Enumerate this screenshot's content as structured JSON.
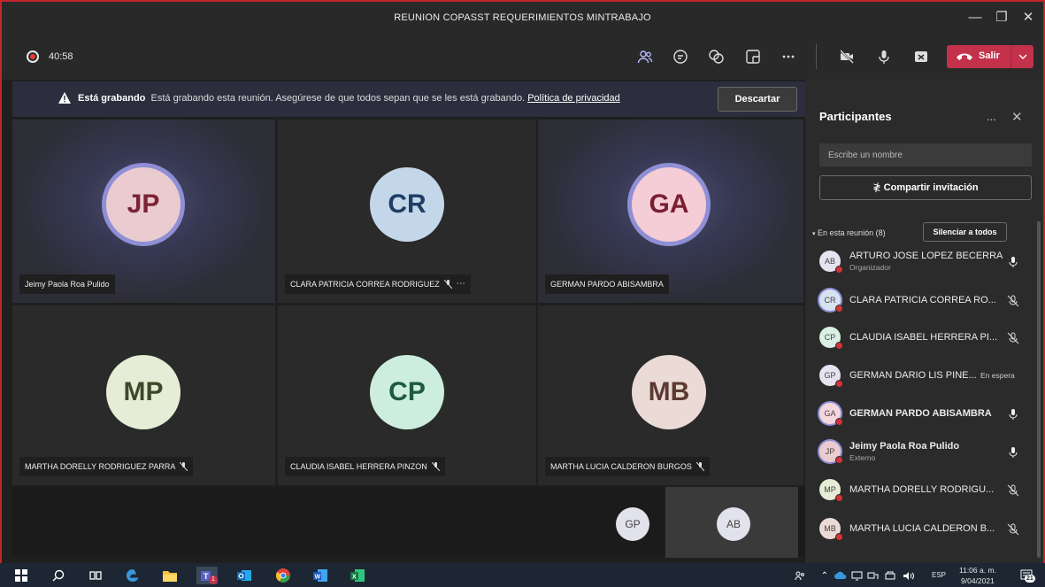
{
  "window": {
    "title": "REUNION COPASST REQUERIMIENTOS MINTRABAJO"
  },
  "toolbar": {
    "timer": "40:58",
    "leave_label": "Salir"
  },
  "banner": {
    "bold": "Está grabando",
    "text": "Está grabando esta reunión. Asegúrese de que todos sepan que se les está grabando.",
    "link": "Política de privacidad",
    "dismiss": "Descartar"
  },
  "tiles": [
    {
      "initials": "JP",
      "name": "Jeimy Paola Roa Pulido",
      "bg": "#eacbcf",
      "fg": "#7a2335"
    },
    {
      "initials": "CR",
      "name": "CLARA PATRICIA CORREA RODRIGUEZ",
      "bg": "#c4d7ea",
      "fg": "#1f3e64"
    },
    {
      "initials": "GA",
      "name": "GERMAN PARDO ABISAMBRA",
      "bg": "#f5cdd6",
      "fg": "#7a1f32"
    },
    {
      "initials": "MP",
      "name": "MARTHA DORELLY RODRIGUEZ PARRA",
      "bg": "#e6edd6",
      "fg": "#3c4a2a"
    },
    {
      "initials": "CP",
      "name": "CLAUDIA ISABEL HERRERA PINZON",
      "bg": "#cdeedf",
      "fg": "#1e5a3e"
    },
    {
      "initials": "MB",
      "name": "MARTHA LUCIA CALDERON BURGOS",
      "bg": "#eadbd6",
      "fg": "#5c3a32"
    }
  ],
  "small_tiles": [
    {
      "initials": "GP"
    },
    {
      "initials": "AB"
    }
  ],
  "panel": {
    "title": "Participantes",
    "more": "...",
    "search_placeholder": "Escribe un nombre",
    "share": "Compartir invitación",
    "section": "En esta reunión (8)",
    "mute_all": "Silenciar a todos",
    "participants": [
      {
        "initials": "AB",
        "name": "ARTURO JOSE LOPEZ BECERRA",
        "role": "Organizador",
        "icon": "mic-icon"
      },
      {
        "initials": "CR",
        "name": "CLARA PATRICIA CORREA RO...",
        "icon": "mic-off-icon"
      },
      {
        "initials": "CP",
        "name": "CLAUDIA ISABEL HERRERA PI...",
        "icon": "mic-off-icon"
      },
      {
        "initials": "GP",
        "name": "GERMAN DARIO LIS PINE...",
        "status": "En espera"
      },
      {
        "initials": "GA",
        "name": "GERMAN PARDO ABISAMBRA",
        "icon": "mic-icon"
      },
      {
        "initials": "JP",
        "name": "Jeimy Paola Roa Pulido",
        "role": "Externo",
        "icon": "mic-icon"
      },
      {
        "initials": "MP",
        "name": "MARTHA DORELLY RODRIGU...",
        "icon": "mic-off-icon"
      },
      {
        "initials": "MB",
        "name": "MARTHA LUCIA CALDERON B...",
        "icon": "mic-off-icon"
      }
    ]
  },
  "taskbar": {
    "teams_badge": "1",
    "lang": "ESP",
    "time": "11:06 a. m.",
    "date": "9/04/2021",
    "notif_count": "21"
  },
  "colors": {
    "leave": "#c4314b",
    "recording": "#e83b3b",
    "ring": "#8f8fd6"
  }
}
